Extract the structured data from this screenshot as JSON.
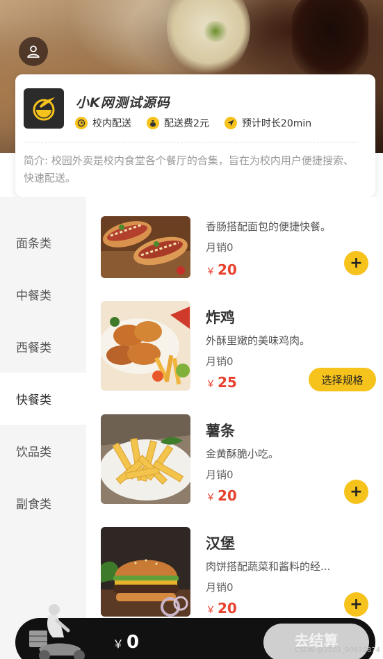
{
  "shop": {
    "name": "小K网测试源码",
    "tags": [
      {
        "icon": "clock-icon",
        "label": "校内配送"
      },
      {
        "icon": "money-bag-icon",
        "label": "配送费2元"
      },
      {
        "icon": "location-arrow-icon",
        "label": "预计时长20min"
      }
    ],
    "intro": "简介: 校园外卖是校内食堂各个餐厅的合集，旨在为校内用户便捷搜索、快速配送。"
  },
  "categories": [
    {
      "label": "面条类",
      "active": false
    },
    {
      "label": "中餐类",
      "active": false
    },
    {
      "label": "西餐类",
      "active": false
    },
    {
      "label": "快餐类",
      "active": true
    },
    {
      "label": "饮品类",
      "active": false
    },
    {
      "label": "副食类",
      "active": false
    }
  ],
  "foods": [
    {
      "name": "",
      "desc": "香肠搭配面包的便捷快餐。",
      "sales": "月销0",
      "currency": "￥",
      "price": "20",
      "action": "add"
    },
    {
      "name": "炸鸡",
      "desc": "外酥里嫩的美味鸡肉。",
      "sales": "月销0",
      "currency": "￥",
      "price": "25",
      "action": "spec",
      "action_label": "选择规格"
    },
    {
      "name": "薯条",
      "desc": "金黄酥脆小吃。",
      "sales": "月销0",
      "currency": "￥",
      "price": "20",
      "action": "add"
    },
    {
      "name": "汉堡",
      "desc": "肉饼搭配蔬菜和酱料的经...",
      "sales": "月销0",
      "currency": "￥",
      "price": "20",
      "action": "add"
    }
  ],
  "add_label": "+",
  "cart": {
    "currency": "￥",
    "total": "0",
    "checkout_label": "去结算"
  },
  "watermark": "CSDN @2501_90630874",
  "colors": {
    "accent": "#f6c21c",
    "price": "#e8412e",
    "cart_bar": "#111111"
  }
}
